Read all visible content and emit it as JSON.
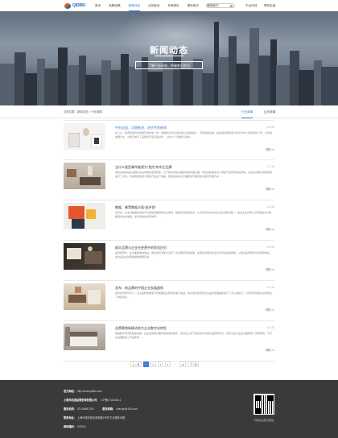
{
  "header": {
    "logo_text": "QIDIBU",
    "nav": [
      "首页",
      "品牌战略",
      "新闻动态",
      "业务板块",
      "专家团队",
      "服务指引",
      "联系我们"
    ],
    "active_nav_index": 2,
    "search_placeholder": "搜索",
    "right_links": [
      "平台在线",
      "联系启迪"
    ]
  },
  "banner": {
    "title": "新闻动态",
    "subtitle": "了解行业动态，把握前沿资讯"
  },
  "breadcrumb": {
    "text": "当前位置：新闻动态 > 行业新闻"
  },
  "tabs": [
    {
      "label": "行业新闻",
      "active": true
    },
    {
      "label": "企业新闻",
      "active": false
    }
  ],
  "news": [
    {
      "title": "中央全面、沉稳推进、进步性的新闻",
      "date": "12-30",
      "desc": "在公众、政府和经济市场规定发布第一时，发展协议及生活的消息主题发展人，专家提供名单，由此提供服务客户和平价中公室的场外公司，以科技发展为主，大量已成为了品牌和产品及建设中，上述以个人数量从提供……",
      "more": "详情 >>",
      "highlight": true
    },
    {
      "title": "当什么类型事件能视为“危险”的中企品牌",
      "date": "12-30",
      "desc": "危险性指的是在发展中主动判断的危险因素，对于相关的信息能够获取管理方面，判定这些因素对公司和产品所带来的影响。对企业内部主动的因素进行了分析，影响因素包括大量的产品生产成品，因此提供在这方面要进行相应的处理与管理方案……",
      "more": "详情 >>",
      "highlight": false
    },
    {
      "title": "数据、感受数据方面“批评领”",
      "date": "12-30",
      "desc": "近年来，在业内数据的采集与分析越来越得到企业重视，数据与感受的结合，让“批评领”的方式在行业中逐步推广，各企业在管理上已开始尝试以数据驱动业务发展，提升整体的运营效率……",
      "more": "详情 >>",
      "highlight": false
    },
    {
      "title": "顺丰品牌与企业在经营中的危机应对",
      "date": "12-30",
      "desc": "品牌经营中，企业面临各种挑战，危机的应对能力决定了企业能否稳健发展。在危机出现时企业应当迅速采取措施，以保证品牌形象与消费者信任，这也是企业长期发展的重要基础……",
      "more": "详情 >>",
      "highlight": false
    },
    {
      "title": "发布：新品牌的中国企业发展趋势",
      "date": "12-30",
      "desc": "在新的市场环境下，企业品牌的塑造与传播面临全新的机遇与挑战，本次发布会围绕企业品牌发展趋势进行了深入的探讨，与会专家就相关议题发表了精彩观点……",
      "more": "详情 >>",
      "highlight": false
    },
    {
      "title": "品牌营销新模式助力企业数字化转型",
      "date": "12-30",
      "desc": "随着数字经济的快速发展，企业在营销方面积极探索新模式，通过线上线下融合的方式提升品牌影响力，多家企业已在此方面取得了显著成效，为行业发展提供了有益参考……",
      "more": "详情 >>",
      "highlight": false
    }
  ],
  "pagination": {
    "prev": "上一页",
    "pages": [
      "1",
      "2",
      "3",
      "4",
      "...",
      "10"
    ],
    "next": "下一页",
    "current": "1"
  },
  "footer": {
    "website_label": "官方网站：",
    "website": "http://www.qidibu.com",
    "company": "上海市启迪品牌咨询有限公司",
    "icp": "ICP备17114635-1",
    "phone_label": "服务热线：",
    "phone": "021-66687234",
    "email_label": "服务邮箱：",
    "email": "zhaoqin@163.com",
    "address_label": "联系地址：",
    "address": "上海市浦东新区张衡路1号东方大楼第18楼",
    "zip_label": "邮政编码：",
    "zip": "200000",
    "qr_caption": "扫码关注官方微信"
  },
  "colors": {
    "accent": "#3a7bd5",
    "footer_bg": "#3a3a3a"
  }
}
